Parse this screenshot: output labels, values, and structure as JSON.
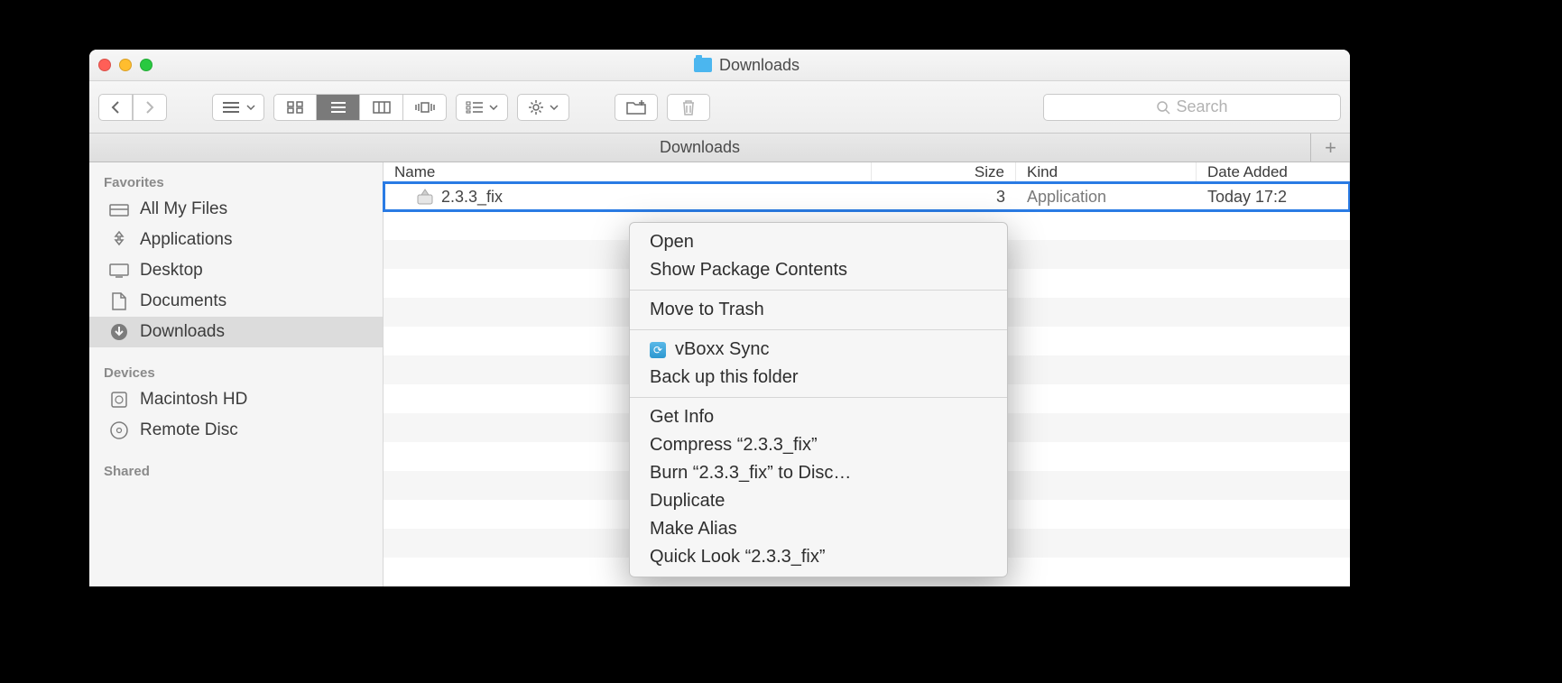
{
  "window": {
    "title": "Downloads"
  },
  "toolbar": {
    "search_placeholder": "Search"
  },
  "pathbar": {
    "label": "Downloads"
  },
  "sidebar": {
    "sections": [
      {
        "header": "Favorites",
        "items": [
          {
            "label": "All My Files",
            "icon": "all-my-files"
          },
          {
            "label": "Applications",
            "icon": "applications"
          },
          {
            "label": "Desktop",
            "icon": "desktop"
          },
          {
            "label": "Documents",
            "icon": "documents"
          },
          {
            "label": "Downloads",
            "icon": "downloads",
            "selected": true
          }
        ]
      },
      {
        "header": "Devices",
        "items": [
          {
            "label": "Macintosh HD",
            "icon": "hdd"
          },
          {
            "label": "Remote Disc",
            "icon": "disc"
          }
        ]
      },
      {
        "header": "Shared",
        "items": []
      }
    ]
  },
  "columns": {
    "name": "Name",
    "size": "Size",
    "kind": "Kind",
    "date": "Date Added"
  },
  "files": [
    {
      "name": "2.3.3_fix",
      "size_suffix": "3",
      "kind": "Application",
      "date": "Today 17:2",
      "selected": true
    }
  ],
  "context_menu": {
    "groups": [
      [
        {
          "label": "Open"
        },
        {
          "label": "Show Package Contents"
        }
      ],
      [
        {
          "label": "Move to Trash"
        }
      ],
      [
        {
          "label": "vBoxx Sync",
          "icon": "vboxx"
        },
        {
          "label": "Back up this folder"
        }
      ],
      [
        {
          "label": "Get Info"
        },
        {
          "label": "Compress “2.3.3_fix”"
        },
        {
          "label": "Burn “2.3.3_fix” to Disc…"
        },
        {
          "label": "Duplicate"
        },
        {
          "label": "Make Alias"
        },
        {
          "label": "Quick Look “2.3.3_fix”"
        }
      ]
    ]
  }
}
